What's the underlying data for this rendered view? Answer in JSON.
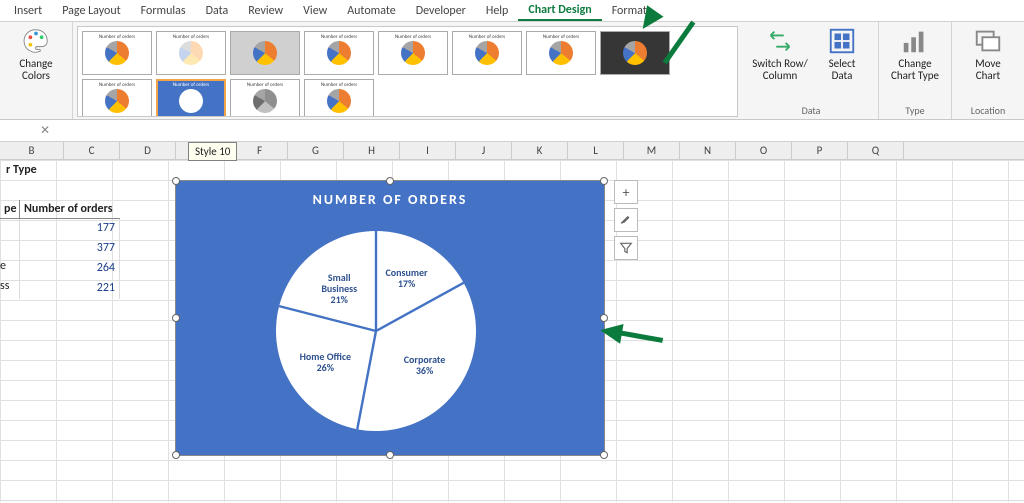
{
  "tabs": [
    "Insert",
    "Page Layout",
    "Formulas",
    "Data",
    "Review",
    "View",
    "Automate",
    "Developer",
    "Help",
    "Chart Design",
    "Format"
  ],
  "active_tab_index": 9,
  "ribbon": {
    "change_colors": "Change\nColors",
    "data_group": "Data",
    "switch_rc": "Switch Row/\nColumn",
    "select_data": "Select\nData",
    "type_group": "Type",
    "change_type": "Change\nChart Type",
    "location_group": "Location",
    "move_chart": "Move\nChart"
  },
  "tooltip": "Style 10",
  "sheet_cols": [
    "B",
    "C",
    "D",
    "E",
    "F",
    "G",
    "H",
    "I",
    "J",
    "K",
    "L",
    "M",
    "N",
    "O",
    "P",
    "Q"
  ],
  "table": {
    "title": "r Type",
    "col1": "pe",
    "col2": "Number of orders",
    "rows": [
      {
        "label": "",
        "value": 177
      },
      {
        "label": "",
        "value": 377
      },
      {
        "label": "e",
        "value": 264
      },
      {
        "label": "ss",
        "value": 221
      }
    ]
  },
  "chart_data": {
    "type": "pie",
    "title": "NUMBER OF ORDERS",
    "series": [
      {
        "name": "Consumer",
        "value": 17
      },
      {
        "name": "Corporate",
        "value": 36
      },
      {
        "name": "Home Office",
        "value": 26
      },
      {
        "name": "Small Business",
        "value": 21
      }
    ]
  },
  "chart_buttons": {
    "plus": "+",
    "brush": "brush-icon",
    "filter": "filter-icon"
  }
}
